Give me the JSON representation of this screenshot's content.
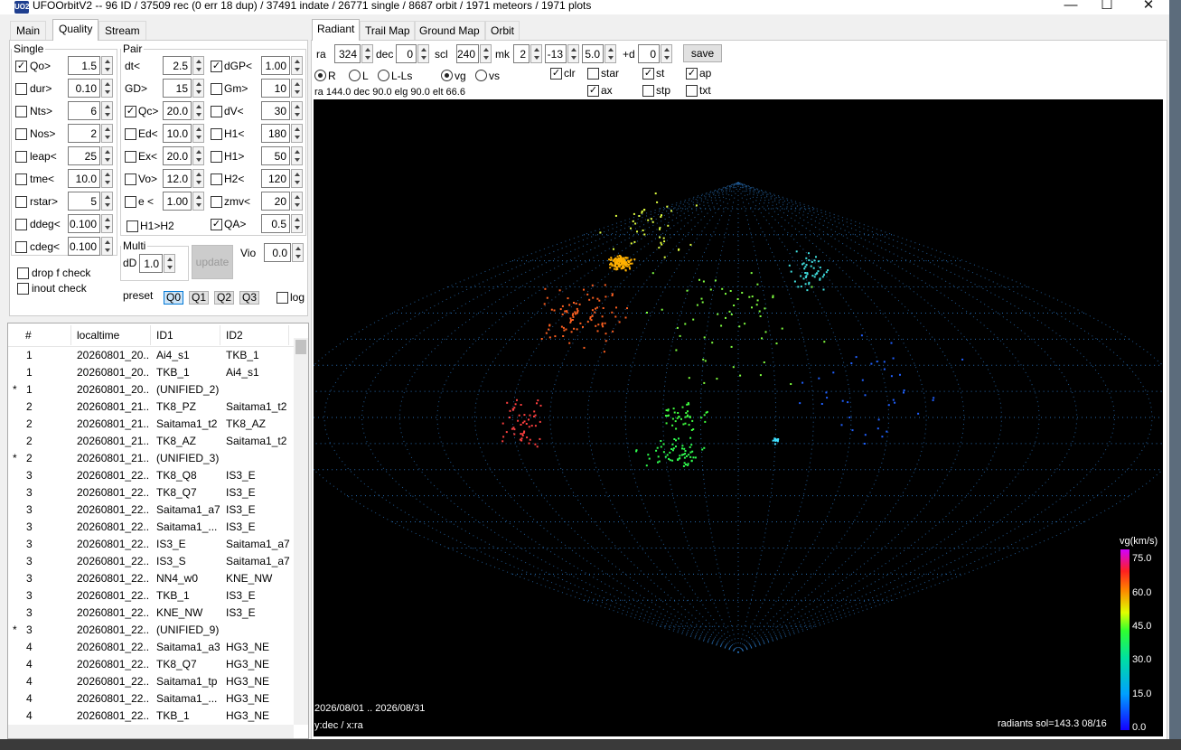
{
  "window": {
    "title": "UFOOrbitV2 -- 96 ID / 37509 rec (0 err 18 dup) / 37491 indate / 26771 single / 8687 orbit / 1971 meteors / 1971 plots",
    "icon_label": "UO2",
    "minimize": "—",
    "maximize": "☐",
    "close": "✕"
  },
  "left_tabs": [
    "Main",
    "Quality",
    "Stream"
  ],
  "single": {
    "legend": "Single",
    "rows": [
      {
        "label": "Qo>",
        "checked": true,
        "value": "1.5"
      },
      {
        "label": "dur>",
        "checked": false,
        "value": "0.10"
      },
      {
        "label": "Nts>",
        "checked": false,
        "value": "6"
      },
      {
        "label": "Nos>",
        "checked": false,
        "value": "2"
      },
      {
        "label": "leap<",
        "checked": false,
        "value": "25"
      },
      {
        "label": "tme<",
        "checked": false,
        "value": "10.0"
      },
      {
        "label": "rstar>",
        "checked": false,
        "value": "5"
      },
      {
        "label": "ddeg<",
        "checked": false,
        "value": "0.100"
      },
      {
        "label": "cdeg<",
        "checked": false,
        "value": "0.100"
      }
    ],
    "drop_f_check": "drop f check",
    "inout_check": "inout check"
  },
  "pair": {
    "legend": "Pair",
    "col1": [
      {
        "label": "dt<",
        "checkbox": false,
        "checked": false,
        "value": "2.5"
      },
      {
        "label": "GD>",
        "checkbox": false,
        "checked": false,
        "value": "15"
      },
      {
        "label": "Qc>",
        "checkbox": true,
        "checked": true,
        "value": "20.0"
      },
      {
        "label": "Ed<",
        "checkbox": true,
        "checked": false,
        "value": "10.0"
      },
      {
        "label": "Ex<",
        "checkbox": true,
        "checked": false,
        "value": "20.0"
      },
      {
        "label": "Vo>",
        "checkbox": true,
        "checked": false,
        "value": "12.0"
      },
      {
        "label": "e <",
        "checkbox": true,
        "checked": false,
        "value": "1.00"
      }
    ],
    "col2": [
      {
        "label": "dGP<",
        "checked": true,
        "value": "1.00"
      },
      {
        "label": "Gm>",
        "checked": false,
        "value": "10"
      },
      {
        "label": "dV<",
        "checked": false,
        "value": "30"
      },
      {
        "label": "H1<",
        "checked": false,
        "value": "180"
      },
      {
        "label": "H1>",
        "checked": false,
        "value": "50"
      },
      {
        "label": "H2<",
        "checked": false,
        "value": "120"
      },
      {
        "label": "zmv<",
        "checked": false,
        "value": "20"
      },
      {
        "label": "QA>",
        "checked": true,
        "value": "0.5"
      }
    ],
    "h1h2": "H1>H2"
  },
  "multi": {
    "legend": "Multi",
    "dD_label": "dD",
    "dD_value": "1.0",
    "update": "update",
    "vio_label": "Vio",
    "vio_value": "0.0"
  },
  "preset": {
    "label": "preset",
    "buttons": [
      "Q0",
      "Q1",
      "Q2",
      "Q3"
    ],
    "selected": "Q0",
    "log": "log"
  },
  "list": {
    "headers": [
      "#",
      "localtime",
      "ID1",
      "ID2"
    ],
    "rows": [
      {
        "mark": "",
        "n": "1",
        "time": "20260801_20...",
        "id1": "Ai4_s1",
        "id2": "TKB_1"
      },
      {
        "mark": "",
        "n": "1",
        "time": "20260801_20...",
        "id1": "TKB_1",
        "id2": "Ai4_s1"
      },
      {
        "mark": "*",
        "n": "1",
        "time": "20260801_20...",
        "id1": "(UNIFIED_2)",
        "id2": ""
      },
      {
        "mark": "",
        "n": "2",
        "time": "20260801_21...",
        "id1": "TK8_PZ",
        "id2": "Saitama1_t2"
      },
      {
        "mark": "",
        "n": "2",
        "time": "20260801_21...",
        "id1": "Saitama1_t2",
        "id2": "TK8_AZ"
      },
      {
        "mark": "",
        "n": "2",
        "time": "20260801_21...",
        "id1": "TK8_AZ",
        "id2": "Saitama1_t2"
      },
      {
        "mark": "*",
        "n": "2",
        "time": "20260801_21...",
        "id1": "(UNIFIED_3)",
        "id2": ""
      },
      {
        "mark": "",
        "n": "3",
        "time": "20260801_22...",
        "id1": "TK8_Q8",
        "id2": "IS3_E"
      },
      {
        "mark": "",
        "n": "3",
        "time": "20260801_22...",
        "id1": "TK8_Q7",
        "id2": "IS3_E"
      },
      {
        "mark": "",
        "n": "3",
        "time": "20260801_22...",
        "id1": "Saitama1_a7",
        "id2": "IS3_E"
      },
      {
        "mark": "",
        "n": "3",
        "time": "20260801_22...",
        "id1": "Saitama1_...",
        "id2": "IS3_E"
      },
      {
        "mark": "",
        "n": "3",
        "time": "20260801_22...",
        "id1": "IS3_E",
        "id2": "Saitama1_a7"
      },
      {
        "mark": "",
        "n": "3",
        "time": "20260801_22...",
        "id1": "IS3_S",
        "id2": "Saitama1_a7"
      },
      {
        "mark": "",
        "n": "3",
        "time": "20260801_22...",
        "id1": "NN4_w0",
        "id2": "KNE_NW"
      },
      {
        "mark": "",
        "n": "3",
        "time": "20260801_22...",
        "id1": "TKB_1",
        "id2": "IS3_E"
      },
      {
        "mark": "",
        "n": "3",
        "time": "20260801_22...",
        "id1": "KNE_NW",
        "id2": "IS3_E"
      },
      {
        "mark": "*",
        "n": "3",
        "time": "20260801_22...",
        "id1": "(UNIFIED_9)",
        "id2": ""
      },
      {
        "mark": "",
        "n": "4",
        "time": "20260801_22...",
        "id1": "Saitama1_a3",
        "id2": "HG3_NE"
      },
      {
        "mark": "",
        "n": "4",
        "time": "20260801_22...",
        "id1": "TK8_Q7",
        "id2": "HG3_NE"
      },
      {
        "mark": "",
        "n": "4",
        "time": "20260801_22...",
        "id1": "Saitama1_tp",
        "id2": "HG3_NE"
      },
      {
        "mark": "",
        "n": "4",
        "time": "20260801_22...",
        "id1": "Saitama1_...",
        "id2": "HG3_NE"
      },
      {
        "mark": "",
        "n": "4",
        "time": "20260801_22...",
        "id1": "TKB_1",
        "id2": "HG3_NE"
      }
    ]
  },
  "right_tabs": [
    "Radiant",
    "Trail Map",
    "Ground Map",
    "Orbit"
  ],
  "controls": {
    "ra_label": "ra",
    "ra_value": "324",
    "dec_label": "dec",
    "dec_value": "0",
    "scl_label": "scl",
    "scl_value": "240",
    "mk_label": "mk",
    "mk_value": "2",
    "v13": "-13",
    "v50": "5.0",
    "d_label": "+d",
    "d_value": "0",
    "save": "save",
    "radios": [
      {
        "label": "R",
        "on": true
      },
      {
        "label": "L",
        "on": false
      },
      {
        "label": "L-Ls",
        "on": false
      },
      {
        "label": "vg",
        "on": true
      },
      {
        "label": "vs",
        "on": false
      }
    ],
    "checks": [
      {
        "label": "clr",
        "on": true
      },
      {
        "label": "star",
        "on": false
      },
      {
        "label": "st",
        "on": true
      },
      {
        "label": "ap",
        "on": true
      },
      {
        "label": "ax",
        "on": true
      },
      {
        "label": "stp",
        "on": false
      },
      {
        "label": "txt",
        "on": false
      }
    ],
    "status": "ra 144.0 dec 90.0 elg 90.0 elt 66.6"
  },
  "plot": {
    "date_range": "2026/08/01 .. 2026/08/31",
    "axes": "y:dec / x:ra",
    "footer": "radiants sol=143.3 08/16",
    "colorbar_title": "vg(km/s)",
    "colorbar_ticks": [
      "75.0",
      "60.0",
      "45.0",
      "30.0",
      "15.0",
      "0.0"
    ]
  },
  "colors": {
    "accent": "#0078d7",
    "plot_bg": "#000000",
    "grid": "#2d7fd0"
  }
}
